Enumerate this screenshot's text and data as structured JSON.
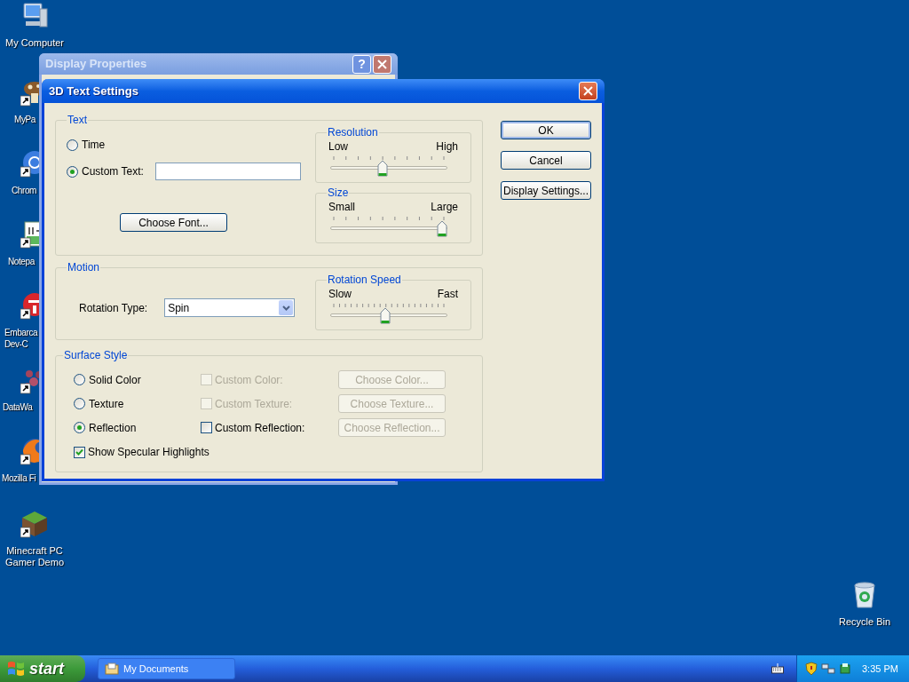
{
  "desktop_icons": [
    {
      "kind": "computer",
      "label": "My Computer",
      "shortcut": false
    },
    {
      "kind": "mushroom",
      "label": "MyPa",
      "shortcut": true
    },
    {
      "kind": "browser",
      "label": "Chrom",
      "shortcut": true
    },
    {
      "kind": "notepad",
      "label": "Notepa",
      "shortcut": true
    },
    {
      "kind": "dev",
      "label": "Embarca Dev-C",
      "shortcut": true
    },
    {
      "kind": "dots",
      "label": "DataWa",
      "shortcut": true
    },
    {
      "kind": "fox",
      "label": "Mozilla Fi",
      "shortcut": true
    },
    {
      "kind": "block",
      "label": "Minecraft PC Gamer Demo",
      "shortcut": true
    },
    {
      "kind": "bin",
      "label": "Recycle Bin",
      "shortcut": false
    }
  ],
  "background_window": {
    "title": "Display Properties",
    "help_button": "?"
  },
  "dialog": {
    "title": "3D Text Settings",
    "text_group": {
      "title": "Text",
      "options": [
        {
          "label": "Time",
          "selected": false
        },
        {
          "label": "Custom Text:",
          "selected": true
        }
      ],
      "choose_font_button": "Choose Font...",
      "sliders": [
        {
          "title": "Resolution",
          "min_label": "Low",
          "max_label": "High",
          "level": 0.44
        },
        {
          "title": "Size",
          "min_label": "Small",
          "max_label": "Large",
          "level": 1
        }
      ]
    },
    "motion_group": {
      "title": "Motion",
      "rotation_type_label": "Rotation Type:",
      "rotation_type_value": "Spin",
      "rotation_speed": {
        "title": "Rotation Speed",
        "min_label": "Slow",
        "max_label": "Fast",
        "level": 0.47
      }
    },
    "surface_group": {
      "title": "Surface Style",
      "rows": [
        {
          "label": "Solid Color",
          "selected": false,
          "custom": {
            "label": "Custom Color:",
            "checked": false,
            "disabled": true
          },
          "button": {
            "label": "Choose Color...",
            "disabled": true
          }
        },
        {
          "label": "Texture",
          "selected": false,
          "custom": {
            "label": "Custom Texture:",
            "checked": false,
            "disabled": true
          },
          "button": {
            "label": "Choose Texture...",
            "disabled": true
          }
        },
        {
          "label": "Reflection",
          "selected": true,
          "custom": {
            "label": "Custom Reflection:",
            "checked": false,
            "disabled": false
          },
          "button": {
            "label": "Choose Reflection...",
            "disabled": true
          }
        }
      ],
      "specular": {
        "label": "Show Specular Highlights",
        "checked": true
      }
    },
    "buttons": [
      {
        "label": "OK",
        "default": true
      },
      {
        "label": "Cancel",
        "default": false
      },
      {
        "label": "Display Settings...",
        "default": false
      }
    ]
  },
  "taskbar": {
    "start": "start",
    "tasks": [
      {
        "label": "My Documents"
      }
    ],
    "clock": "3:35 PM"
  }
}
